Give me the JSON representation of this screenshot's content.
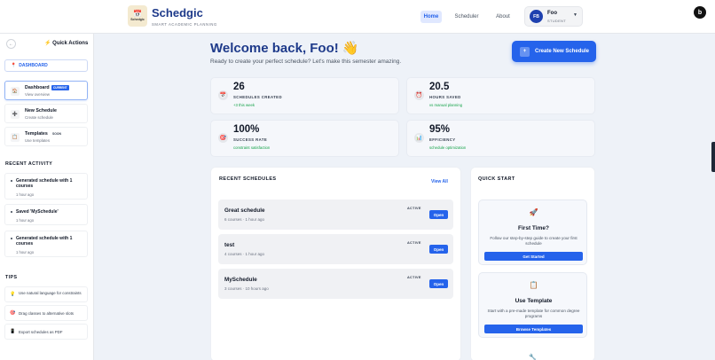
{
  "header": {
    "brand": "Schedgic",
    "tagline": "SMART ACADEMIC PLANNING",
    "logo_text": "Schedgic",
    "nav": [
      "Home",
      "Scheduler",
      "About"
    ],
    "user": {
      "initials": "FB",
      "name": "Foo",
      "role": "STUDENT"
    },
    "corner_badge": "b"
  },
  "sidebar": {
    "back_symbol": "←",
    "title": "Quick Actions",
    "dashboard_link": "DASHBOARD",
    "items": [
      {
        "title": "Dashboard",
        "sub": "View overview",
        "badge": "CURRENT"
      },
      {
        "title": "New Schedule",
        "sub": "Create schedule"
      },
      {
        "title": "Templates",
        "sub": "Use templates",
        "badge": "SOON"
      }
    ],
    "recent_title": "RECENT ACTIVITY",
    "activity": [
      {
        "text": "Generated schedule with 1 courses",
        "time": "1 hour ago"
      },
      {
        "text": "Saved 'MySchedule'",
        "time": "1 hour ago"
      },
      {
        "text": "Generated schedule with 1 courses",
        "time": "1 hour ago"
      }
    ],
    "tips_title": "TIPS",
    "tips": [
      {
        "icon": "💡",
        "text": "Use natural language for constraints"
      },
      {
        "icon": "🎯",
        "text": "Drag classes to alternative slots"
      },
      {
        "icon": "📱",
        "text": "Export schedules as PDF"
      }
    ]
  },
  "main": {
    "welcome": "Welcome back, Foo! 👋",
    "subtitle": "Ready to create your perfect schedule? Let's make this semester amazing.",
    "create_button": "Create New Schedule",
    "create_icon": "+",
    "stats": [
      {
        "icon": "📅",
        "value": "26",
        "label": "SCHEDULES CREATED",
        "note": "+3 this week"
      },
      {
        "icon": "⏰",
        "value": "20.5",
        "label": "HOURS SAVED",
        "note": "vs manual planning"
      },
      {
        "icon": "🎯",
        "value": "100%",
        "label": "SUCCESS RATE",
        "note": "constraint satisfaction"
      },
      {
        "icon": "📊",
        "value": "95%",
        "label": "EFFICIENCY",
        "note": "schedule optimization"
      }
    ],
    "recent": {
      "title": "RECENT SCHEDULES",
      "view_all": "View All",
      "items": [
        {
          "name": "Great schedule",
          "meta": "6 courses · 1 hour ago",
          "status": "ACTIVE",
          "action": "Open"
        },
        {
          "name": "test",
          "meta": "4 courses · 1 hour ago",
          "status": "ACTIVE",
          "action": "Open"
        },
        {
          "name": "MySchedule",
          "meta": "3 courses · 10 hours ago",
          "status": "ACTIVE",
          "action": "Open"
        }
      ]
    },
    "quick_start": {
      "title": "QUICK START",
      "cards": [
        {
          "icon": "🚀",
          "title": "First Time?",
          "desc": "Follow our step-by-step guide to create your first schedule",
          "button": "Get Started"
        },
        {
          "icon": "📋",
          "title": "Use Template",
          "desc": "Start with a pre-made template for common degree programs",
          "button": "Browse Templates"
        }
      ]
    }
  }
}
